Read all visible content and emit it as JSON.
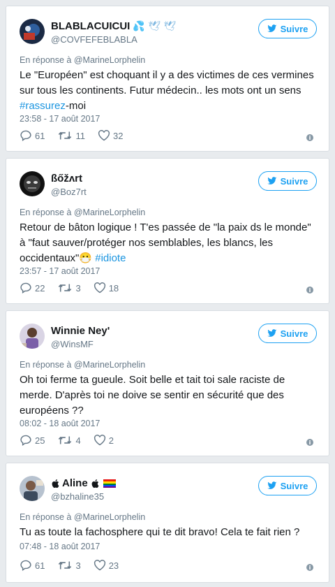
{
  "follow_label": "Suivre",
  "reply_prefix": "En réponse à",
  "info_glyph": "i",
  "accent_color": "#1da1f2",
  "tweets": [
    {
      "name": "BLABLACUICUI",
      "name_emojis": "💦 🕊 🕊",
      "handle": "@COVFEFEBLABLA",
      "reply_to": "@MarineLorphelin",
      "text_before": "Le \"Européen\" est choquant il y a des victimes de ces vermines sur tous les continents. Futur médecin.. les mots ont un sens ",
      "hashtag": "#rassurez",
      "text_after": "-moi",
      "timestamp": "23:58 - 17 août 2017",
      "replies": "61",
      "retweets": "11",
      "likes": "32"
    },
    {
      "name": "ßőžʌrt",
      "name_emojis": "",
      "handle": "@Boz7rt",
      "reply_to": "@MarineLorphelin",
      "text_before": "Retour de bâton logique ! T'es passée de \"la paix ds le monde\" à \"faut sauver/protéger nos semblables, les blancs, les occidentaux\"😷 ",
      "hashtag": "#idiote",
      "text_after": "",
      "timestamp": "23:57 - 17 août 2017",
      "replies": "22",
      "retweets": "3",
      "likes": "18"
    },
    {
      "name": "Winnie Ney'",
      "name_emojis": "",
      "handle": "@WinsMF",
      "reply_to": "@MarineLorphelin",
      "text_before": "Oh toi ferme ta gueule. Soit belle et tait toi sale raciste de merde. D'après toi ne doive se sentir en sécurité que des européens ??",
      "hashtag": "",
      "text_after": "",
      "timestamp": "08:02 - 18 août 2017",
      "replies": "25",
      "retweets": "4",
      "likes": "2"
    },
    {
      "name": "Aline",
      "name_emojis": "🏳️‍🌈",
      "handle": "@bzhaline35",
      "reply_to": "@MarineLorphelin",
      "text_before": "Tu as toute la fachosphere qui te dit bravo! Cela te fait rien ?",
      "hashtag": "",
      "text_after": "",
      "timestamp": "07:48 - 18 août 2017",
      "replies": "61",
      "retweets": "3",
      "likes": "23"
    }
  ]
}
